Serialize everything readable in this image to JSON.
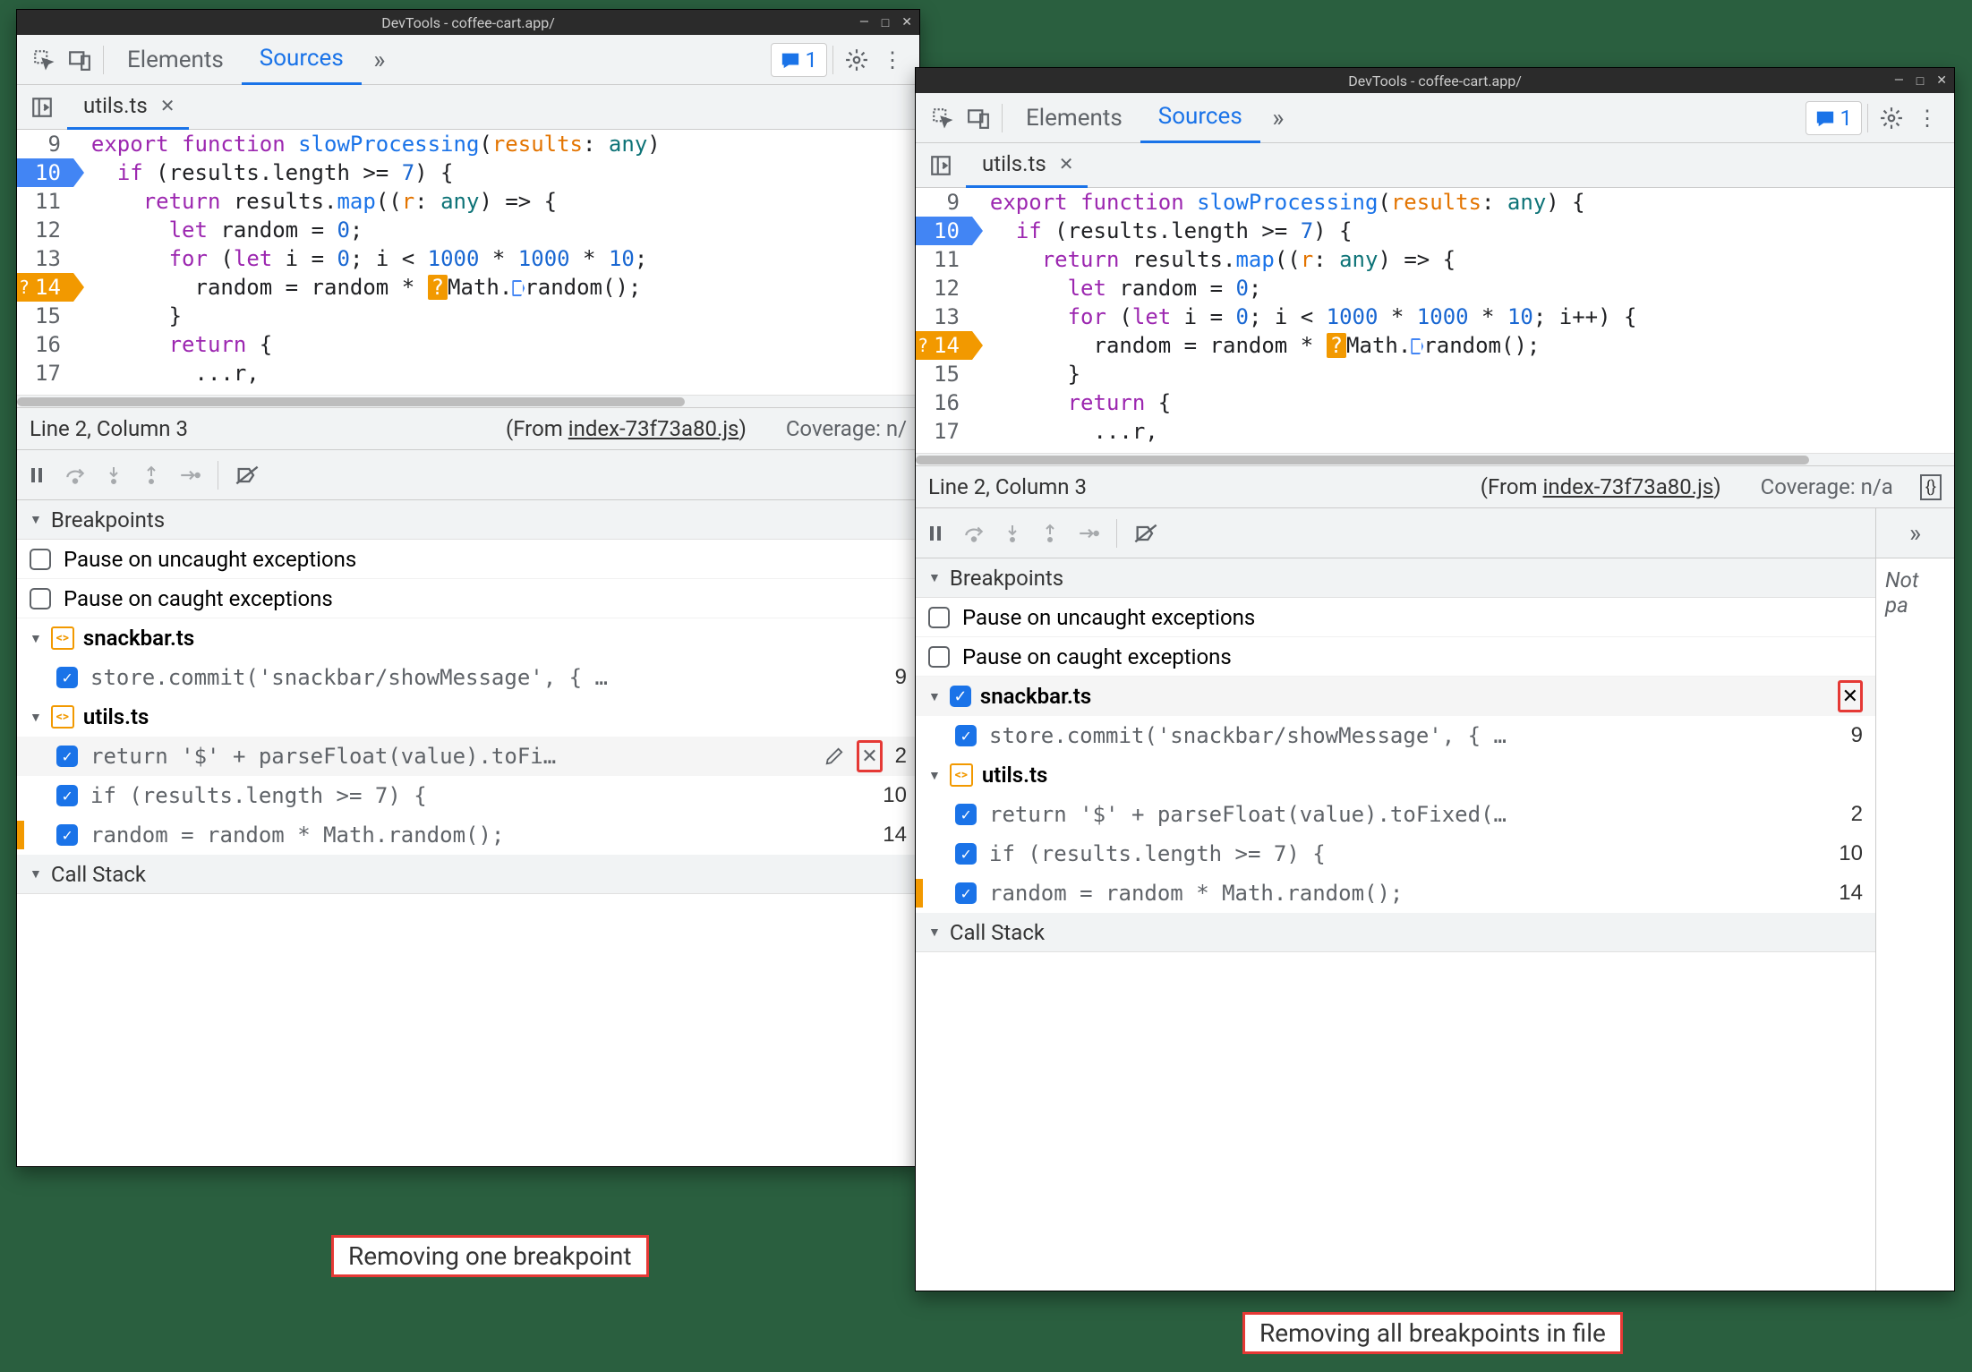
{
  "windows": {
    "left": {
      "title": "DevTools - coffee-cart.app/",
      "toolbar": {
        "tabs": [
          "Elements",
          "Sources"
        ],
        "active": "Sources",
        "messages": "1"
      },
      "editorTab": "utils.ts",
      "gutter_start": 9,
      "code": {
        "l9": "export function slowProcessing(results: any)",
        "l10": "  if (results.length >= 7) {",
        "l11": "    return results.map((r: any) => {",
        "l12": "      let random = 0;",
        "l13": "      for (let i = 0; i < 1000 * 1000 * 10;",
        "l14a": "        random = random * ",
        "l14b": "Math.",
        "l14c": "random();",
        "l15": "      }",
        "l16": "      return {",
        "l17": "        ...r,"
      },
      "status": {
        "cursor": "Line 2, Column 3",
        "from_label": "(From ",
        "from_file": "index-73f73a80.js",
        "from_close": ")",
        "coverage": "Coverage: n/"
      },
      "sections": {
        "breakpoints": "Breakpoints",
        "callstack": "Call Stack"
      },
      "pause": {
        "uncaught": "Pause on uncaught exceptions",
        "caught": "Pause on caught exceptions"
      },
      "groups": {
        "snackbar": {
          "name": "snackbar.ts",
          "items": [
            {
              "text": "store.commit('snackbar/showMessage', { …",
              "line": "9"
            }
          ]
        },
        "utils": {
          "name": "utils.ts",
          "items": [
            {
              "text": "return '$' + parseFloat(value).toFi…",
              "line": "2",
              "hovered": true
            },
            {
              "text": "if (results.length >= 7) {",
              "line": "10"
            },
            {
              "text": "random = random * Math.random();",
              "line": "14",
              "marker": true
            }
          ]
        }
      }
    },
    "right": {
      "title": "DevTools - coffee-cart.app/",
      "toolbar": {
        "tabs": [
          "Elements",
          "Sources"
        ],
        "active": "Sources",
        "messages": "1"
      },
      "editorTab": "utils.ts",
      "code": {
        "l9": "export function slowProcessing(results: any) {",
        "l10": "  if (results.length >= 7) {",
        "l11": "    return results.map((r: any) => {",
        "l12": "      let random = 0;",
        "l13": "      for (let i = 0; i < 1000 * 1000 * 10; i++) {",
        "l14a": "        random = random * ",
        "l14b": "Math.",
        "l14c": "random();",
        "l15": "      }",
        "l16": "      return {",
        "l17": "        ...r,"
      },
      "status": {
        "cursor": "Line 2, Column 3",
        "from_label": "(From ",
        "from_file": "index-73f73a80.js",
        "from_close": ")",
        "coverage": "Coverage: n/a"
      },
      "sidepane": {
        "notpa": "Not pa"
      },
      "sections": {
        "breakpoints": "Breakpoints",
        "callstack": "Call Stack"
      },
      "pause": {
        "uncaught": "Pause on uncaught exceptions",
        "caught": "Pause on caught exceptions"
      },
      "groups": {
        "snackbar": {
          "name": "snackbar.ts",
          "hovered": true,
          "items": [
            {
              "text": "store.commit('snackbar/showMessage', { …",
              "line": "9"
            }
          ]
        },
        "utils": {
          "name": "utils.ts",
          "items": [
            {
              "text": "return '$' + parseFloat(value).toFixed(…",
              "line": "2"
            },
            {
              "text": "if (results.length >= 7) {",
              "line": "10"
            },
            {
              "text": "random = random * Math.random();",
              "line": "14",
              "marker": true
            }
          ]
        }
      }
    }
  },
  "annotations": {
    "left": "Removing one breakpoint",
    "right": "Removing all breakpoints in file"
  }
}
